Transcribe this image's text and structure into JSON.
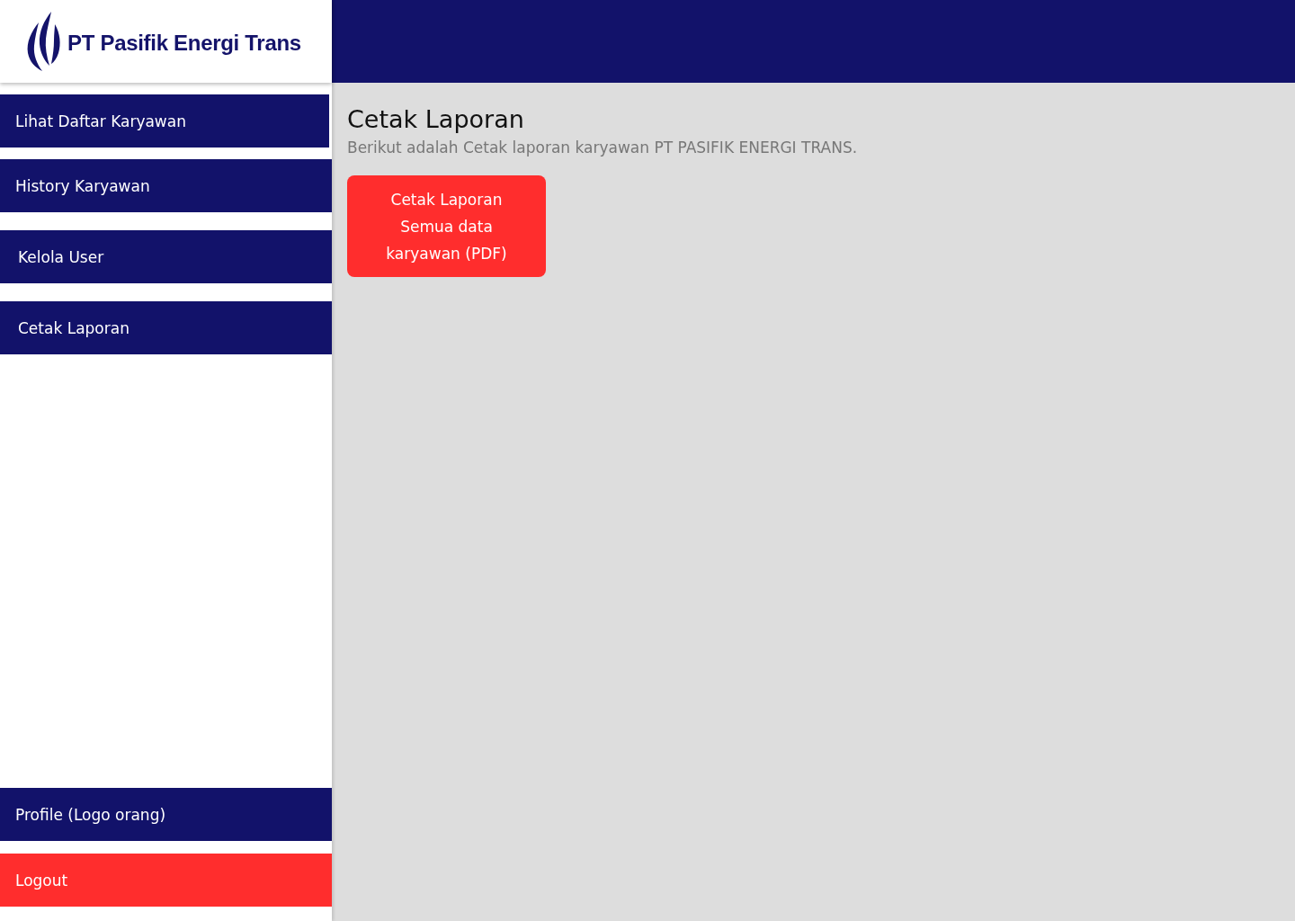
{
  "sidebar": {
    "logo": {
      "text": "PT Pasifik Energi Trans"
    },
    "menu": [
      {
        "label": "Lihat Daftar Karyawan"
      },
      {
        "label": "History Karyawan"
      },
      {
        "label": "Kelola User"
      },
      {
        "label": "Cetak Laporan"
      }
    ],
    "footer": [
      {
        "label": "Profile (Logo orang)",
        "kind": "profile"
      },
      {
        "label": "Logout",
        "kind": "logout"
      }
    ]
  },
  "content": {
    "title": "Cetak Laporan",
    "subtitle": "Berikut adalah Cetak laporan karyawan PT PASIFIK ENERGI TRANS.",
    "buttons": [
      {
        "lines": [
          "Cetak Laporan",
          "Semua data",
          "karyawan (PDF)"
        ]
      }
    ]
  }
}
